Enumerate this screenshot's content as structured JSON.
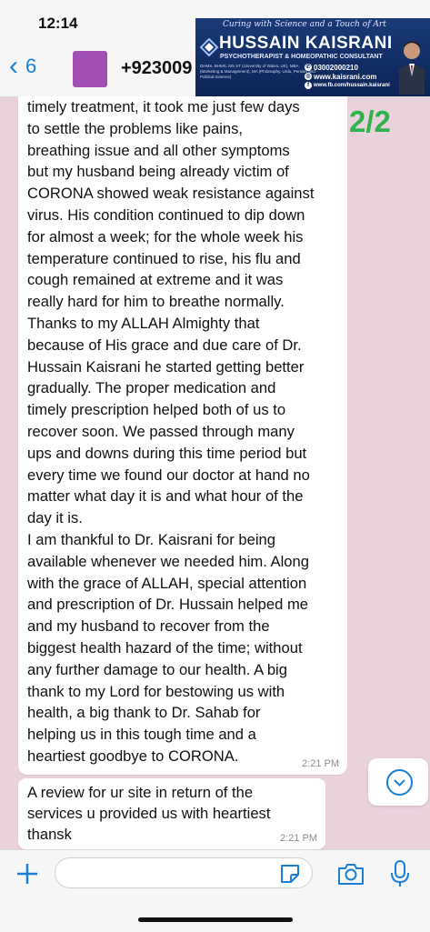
{
  "status_bar": {
    "time": "12:14"
  },
  "header": {
    "back_count": "6",
    "contact": "+923009"
  },
  "banner": {
    "tagline": "Curing with Science  and a Touch of Art",
    "name": "HUSSAIN KAISRANI",
    "subtitle": "PSYCHOTHERAPIST & HOMEOPATHIC CONSULTANT",
    "qualifications": "DHMS, BHMS, MS ST (University of Wales, UK), MBA (Marketing & Management), MA (Philosophy, Urdu, Persian and Political Science)",
    "phone": "03002000210",
    "website": "www.kaisrani.com",
    "facebook": "www.fb.com/hussain.kaisrani"
  },
  "page_counter": "2/2",
  "messages": [
    {
      "text": "timely treatment, it took me just few days\nto settle the problems like pains,\nbreathing issue and all other symptoms\nbut my husband being already victim of\nCORONA showed weak resistance against\nvirus. His condition continued to dip down\nfor almost a week; for the whole week his\ntemperature continued to rise, his flu and\ncough remained at extreme and it was\nreally hard for him to breathe normally.\nThanks to my ALLAH Almighty that\nbecause of His grace and due care of Dr.\nHussain Kaisrani he started getting better\ngradually. The proper medication and\ntimely prescription helped both of us to\nrecover soon. We passed through many\nups and downs during this time period but\nevery time we found our doctor at hand no\nmatter what day it is and what hour of the\nday it is.\nI am thankful to Dr. Kaisrani for being\navailable whenever we needed him. Along\nwith the grace of ALLAH, special attention\nand prescription of Dr. Hussain helped me\nand my husband to recover from the\nbiggest health hazard of the time; without\nany further damage to our health. A big\nthank to my Lord for bestowing us with\nhealth, a big thank to Dr. Sahab for\nhelping us in this tough time and a\nheartiest goodbye to CORONA.",
      "time": "2:21 PM"
    },
    {
      "text": "A review for ur site in return of the\nservices u provided us with heartiest\nthansk",
      "time": "2:21 PM"
    }
  ],
  "input": {
    "value": ""
  },
  "colors": {
    "accent": "#1a7fd4",
    "chat_bg": "#ead2dd",
    "counter": "#2db44a",
    "banner_bg": "#0c2456"
  }
}
